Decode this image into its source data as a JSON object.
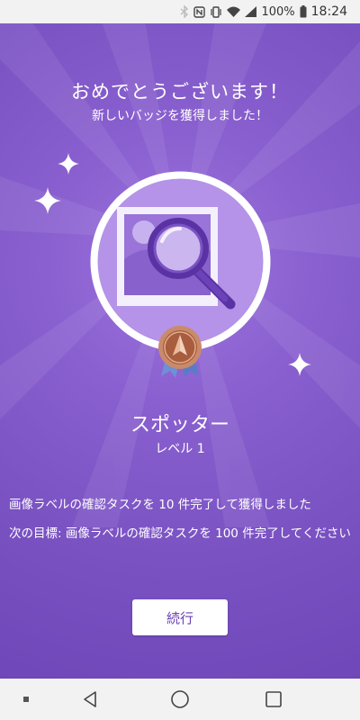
{
  "status_bar": {
    "battery_percent": "100%",
    "time": "18:24",
    "icons": [
      "bluetooth-icon",
      "nfc-icon",
      "vibrate-icon",
      "wifi-icon",
      "signal-icon",
      "battery-icon"
    ]
  },
  "main": {
    "heading": "おめでとうございます！",
    "subheading": "新しいバッジを獲得しました！",
    "badge": {
      "icon": "magnifier-photo-icon",
      "medal_icon": "medal-icon",
      "name": "スポッター",
      "level": "レベル 1"
    },
    "achievement_text": "画像ラベルの確認タスクを 10 件完了して獲得しました",
    "next_goal_text": "次の目標: 画像ラベルの確認タスクを 100 件完了してください",
    "continue_label": "続行"
  },
  "nav_bar": {
    "items": [
      "recents-dot-icon",
      "back-icon",
      "home-icon",
      "overview-icon"
    ]
  },
  "colors": {
    "background": "#7e57c2",
    "button_text": "#6a3fb3",
    "medal": "#b36b45"
  }
}
